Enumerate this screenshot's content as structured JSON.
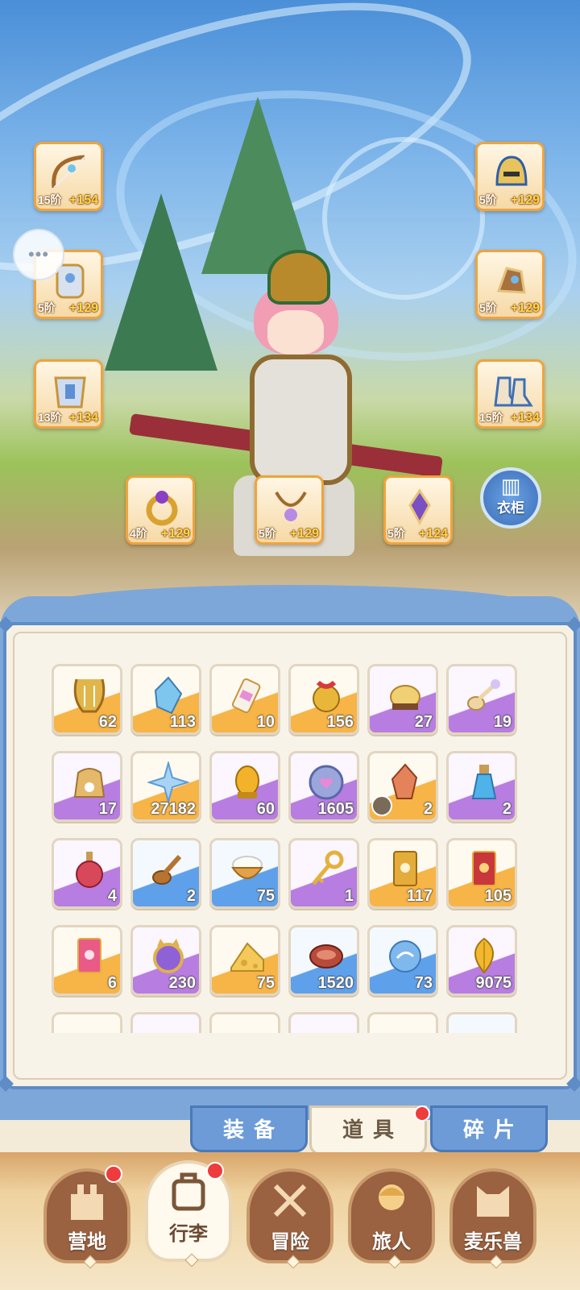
{
  "equipment": [
    {
      "name": "bow",
      "stage": "15阶",
      "bonus": "+154"
    },
    {
      "name": "armor",
      "stage": "5阶",
      "bonus": "+129"
    },
    {
      "name": "chest",
      "stage": "13阶",
      "bonus": "+134"
    },
    {
      "name": "helmet",
      "stage": "5阶",
      "bonus": "+129"
    },
    {
      "name": "gloves",
      "stage": "5阶",
      "bonus": "+129"
    },
    {
      "name": "boots",
      "stage": "15阶",
      "bonus": "+134"
    },
    {
      "name": "ring",
      "stage": "4阶",
      "bonus": "+129"
    },
    {
      "name": "necklace",
      "stage": "5阶",
      "bonus": "+129"
    },
    {
      "name": "charm",
      "stage": "5阶",
      "bonus": "+124"
    }
  ],
  "chat_icon": "•••",
  "wardrobe": {
    "icon": "wardrobe-icon",
    "label": "衣柜"
  },
  "items": [
    {
      "icon": "lyre-icon",
      "qty": "62",
      "rarity": "orange"
    },
    {
      "icon": "crystal-icon",
      "qty": "113",
      "rarity": "orange"
    },
    {
      "icon": "paint-tube-icon",
      "qty": "10",
      "rarity": "orange"
    },
    {
      "icon": "bell-icon",
      "qty": "156",
      "rarity": "orange"
    },
    {
      "icon": "cookie-icon",
      "qty": "27",
      "rarity": "purple"
    },
    {
      "icon": "cat-spoon-icon",
      "qty": "19",
      "rarity": "purple"
    },
    {
      "icon": "flour-sack-icon",
      "qty": "17",
      "rarity": "purple"
    },
    {
      "icon": "star-crystal-icon",
      "qty": "27182",
      "rarity": "orange"
    },
    {
      "icon": "golden-egg-icon",
      "qty": "60",
      "rarity": "purple"
    },
    {
      "icon": "heart-coin-icon",
      "qty": "1605",
      "rarity": "purple"
    },
    {
      "icon": "ore-icon",
      "qty": "2",
      "rarity": "orange"
    },
    {
      "icon": "potion-blue-icon",
      "qty": "2",
      "rarity": "purple"
    },
    {
      "icon": "potion-red-icon",
      "qty": "4",
      "rarity": "purple"
    },
    {
      "icon": "paw-spoon-icon",
      "qty": "2",
      "rarity": "blue"
    },
    {
      "icon": "rice-bowl-icon",
      "qty": "75",
      "rarity": "blue"
    },
    {
      "icon": "key-icon",
      "qty": "1",
      "rarity": "purple"
    },
    {
      "icon": "card-gold-icon",
      "qty": "117",
      "rarity": "orange"
    },
    {
      "icon": "card-red-icon",
      "qty": "105",
      "rarity": "orange"
    },
    {
      "icon": "card-pink-icon",
      "qty": "6",
      "rarity": "orange"
    },
    {
      "icon": "cat-mirror-icon",
      "qty": "230",
      "rarity": "purple"
    },
    {
      "icon": "cheese-icon",
      "qty": "75",
      "rarity": "orange"
    },
    {
      "icon": "meat-icon",
      "qty": "1520",
      "rarity": "blue"
    },
    {
      "icon": "water-orb-icon",
      "qty": "73",
      "rarity": "blue"
    },
    {
      "icon": "golden-leaf-icon",
      "qty": "9075",
      "rarity": "purple"
    },
    {
      "icon": "item-icon",
      "qty": "",
      "rarity": "orange"
    },
    {
      "icon": "item-icon",
      "qty": "",
      "rarity": "purple"
    },
    {
      "icon": "item-icon",
      "qty": "",
      "rarity": "orange"
    },
    {
      "icon": "item-icon",
      "qty": "",
      "rarity": "purple"
    },
    {
      "icon": "item-icon",
      "qty": "",
      "rarity": "orange"
    },
    {
      "icon": "item-icon",
      "qty": "",
      "rarity": "blue"
    }
  ],
  "tabs": [
    {
      "label": "装备",
      "active": false
    },
    {
      "label": "道具",
      "active": true,
      "badge": true
    },
    {
      "label": "碎片",
      "active": false
    }
  ],
  "nav": [
    {
      "label": "营地",
      "icon": "castle-icon",
      "badge": true
    },
    {
      "label": "行李",
      "icon": "backpack-icon",
      "badge": true,
      "active": true
    },
    {
      "label": "冒险",
      "icon": "crossed-swords-icon"
    },
    {
      "label": "旅人",
      "icon": "traveler-icon"
    },
    {
      "label": "麦乐兽",
      "icon": "cat-head-icon"
    }
  ],
  "colors": {
    "orange": "#f7b447",
    "purple": "#b77de0",
    "blue": "#5fa0ea",
    "badge": "#ee3b3b"
  }
}
